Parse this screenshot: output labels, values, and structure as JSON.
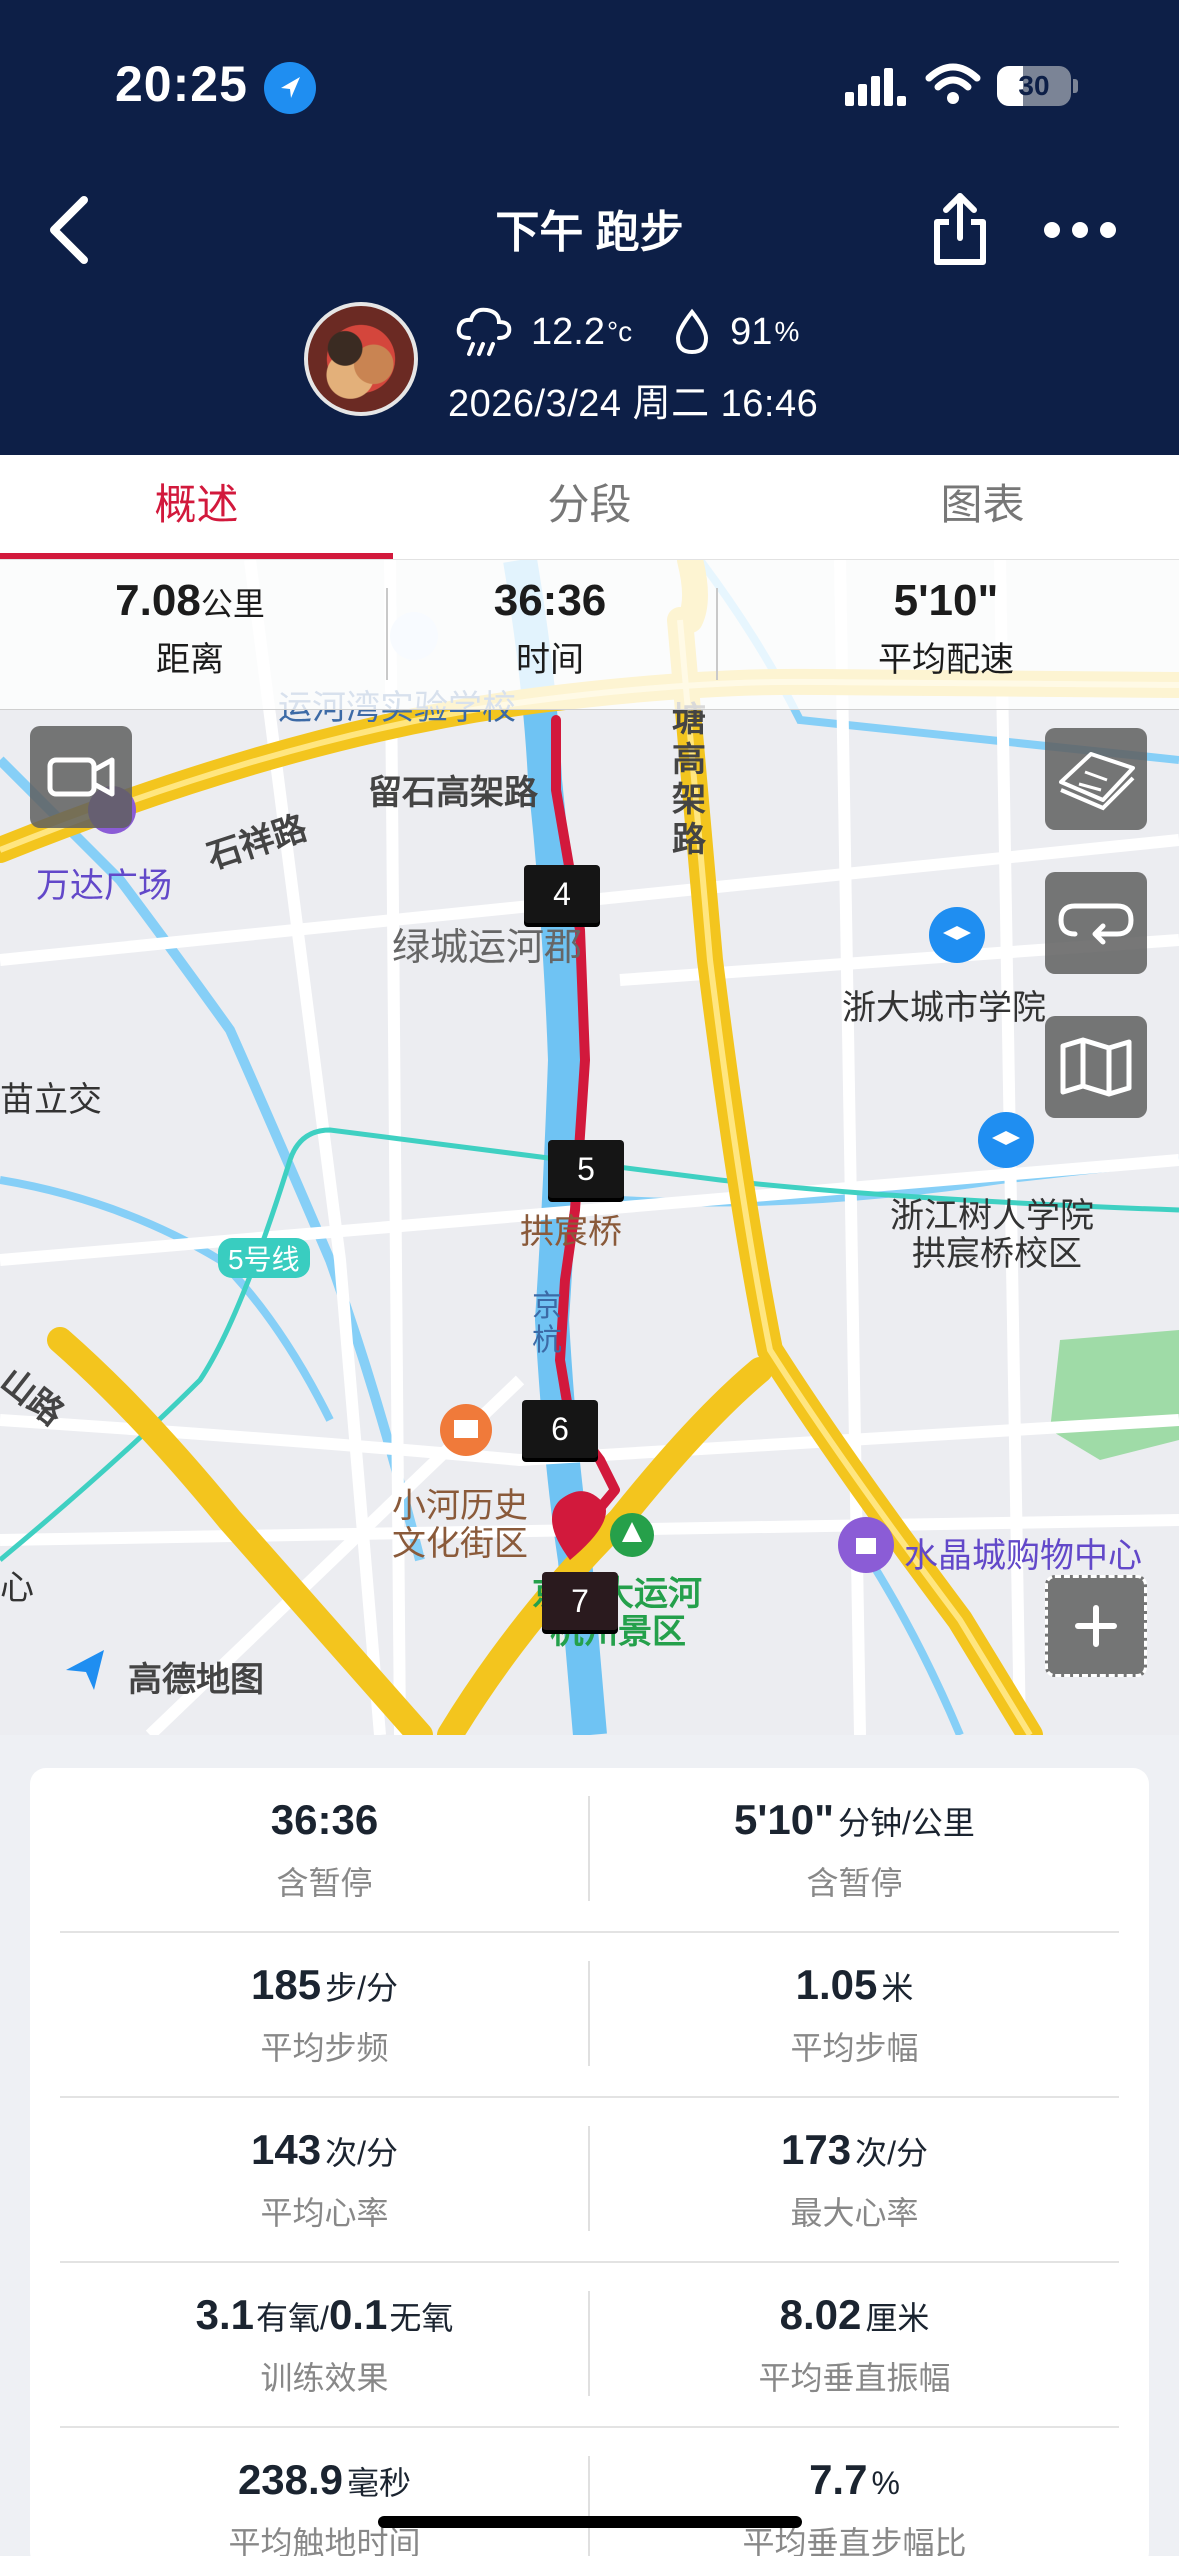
{
  "status_bar": {
    "time": "20:25",
    "battery": "30"
  },
  "header": {
    "title": "下午 跑步",
    "weather": {
      "temp": "12.2",
      "temp_unit": "°c",
      "humidity": "91",
      "humidity_unit": "%"
    },
    "datetime": "2026/3/24 周二 16:46"
  },
  "tabs": [
    {
      "label": "概述",
      "active": true
    },
    {
      "label": "分段",
      "active": false
    },
    {
      "label": "图表",
      "active": false
    }
  ],
  "summary_strip": [
    {
      "value": "7.08",
      "unit": "公里",
      "label": "距离"
    },
    {
      "value": "36:36",
      "unit": "",
      "label": "时间"
    },
    {
      "value": "5'10\"",
      "unit": "",
      "label": "平均配速"
    }
  ],
  "map": {
    "provider": "高德地图",
    "labels": {
      "school": "运河湾实验学校",
      "road_shixiang": "石祥路",
      "road_liushi": "留石高架路",
      "wanda": "万达广场",
      "lvcheng": "绿城运河郡",
      "tanggao": "塘高架路",
      "zhejiang_city": "浙大城市学院",
      "miaoli": "苗立交",
      "gongchen": "拱宸桥",
      "shuren_1": "浙江树人学院",
      "shuren_2": "拱宸桥校区",
      "metro5": "5号线",
      "jinghang": "京杭",
      "xiaohe_1": "小河历史",
      "xiaohe_2": "文化街区",
      "crystal": "水晶城购物中心",
      "canal_1": "京杭大运河",
      "canal_2": "杭州景区",
      "shan_road": "山路",
      "xin": "心",
      "top_road": "上塘高架"
    },
    "km_markers": [
      "4",
      "5",
      "6",
      "7"
    ],
    "route_color": "#d2193c"
  },
  "stats": [
    {
      "left": {
        "value": "36:36",
        "unit": "",
        "label": "含暂停"
      },
      "right": {
        "value": "5'10\"",
        "unit": "分钟/公里",
        "label": "含暂停"
      }
    },
    {
      "left": {
        "value": "185",
        "unit": "步/分",
        "label": "平均步频"
      },
      "right": {
        "value": "1.05",
        "unit": "米",
        "label": "平均步幅"
      }
    },
    {
      "left": {
        "value": "143",
        "unit": "次/分",
        "label": "平均心率"
      },
      "right": {
        "value": "173",
        "unit": "次/分",
        "label": "最大心率"
      }
    },
    {
      "left": {
        "value": "3.1",
        "unit": "有氧/",
        "value2": "0.1",
        "unit2": "无氧",
        "label": "训练效果"
      },
      "right": {
        "value": "8.02",
        "unit": "厘米",
        "label": "平均垂直振幅"
      }
    },
    {
      "left": {
        "value": "238.9",
        "unit": "毫秒",
        "label": "平均触地时间"
      },
      "right": {
        "value": "7.7",
        "unit": "%",
        "label": "平均垂直步幅比"
      }
    }
  ]
}
